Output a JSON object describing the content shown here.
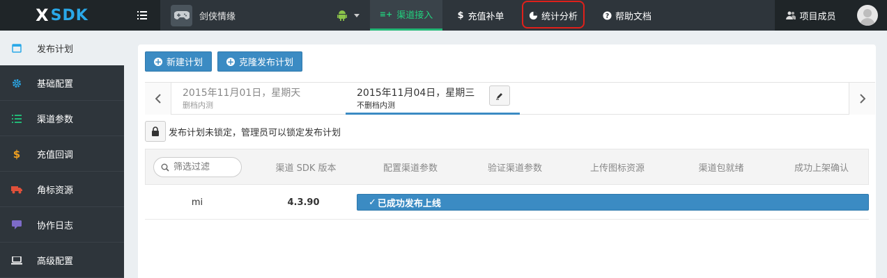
{
  "app": {
    "logo_mark": "X",
    "logo_text": "SDK"
  },
  "header": {
    "game_name": "剑侠情缘",
    "tabs": [
      {
        "label": "渠道接入",
        "icon": "list-add-icon",
        "active": true
      },
      {
        "label": "充值补单",
        "icon": "dollar-icon",
        "active": false
      },
      {
        "label": "统计分析",
        "icon": "pie-chart-icon",
        "active": false,
        "highlighted": true
      },
      {
        "label": "帮助文档",
        "icon": "question-icon",
        "active": false
      }
    ],
    "members_label": "项目成员"
  },
  "sidebar": {
    "items": [
      {
        "label": "发布计划",
        "icon": "calendar-icon",
        "color": "#2aa8e8",
        "active": true
      },
      {
        "label": "基础配置",
        "icon": "gear-icon",
        "color": "#2aa8e8",
        "active": false
      },
      {
        "label": "渠道参数",
        "icon": "list-icon",
        "color": "#22b876",
        "active": false
      },
      {
        "label": "充值回调",
        "icon": "dollar-icon",
        "color": "#f0a020",
        "active": false
      },
      {
        "label": "角标资源",
        "icon": "truck-icon",
        "color": "#e0503a",
        "active": false
      },
      {
        "label": "协作日志",
        "icon": "chat-icon",
        "color": "#7d6bc8",
        "active": false
      },
      {
        "label": "高级配置",
        "icon": "laptop-icon",
        "color": "#ffffff",
        "active": false
      }
    ]
  },
  "main": {
    "buttons": {
      "new_plan": "新建计划",
      "clone_plan": "克隆发布计划"
    },
    "dates": [
      {
        "date": "2015年11月01日，星期天",
        "note": "删档内测",
        "active": false
      },
      {
        "date": "2015年11月04日，星期三",
        "note": "不删档内测",
        "active": true
      }
    ],
    "lock_text": "发布计划未锁定，管理员可以锁定发布计划",
    "filter_placeholder": "筛选过滤",
    "columns": [
      "渠道 SDK 版本",
      "配置渠道参数",
      "验证渠道参数",
      "上传图标资源",
      "渠道包就绪",
      "成功上架确认"
    ],
    "rows": [
      {
        "channel": "mi",
        "sdk_version": "4.3.90",
        "status": "已成功发布上线",
        "progress": 1.0
      }
    ]
  }
}
